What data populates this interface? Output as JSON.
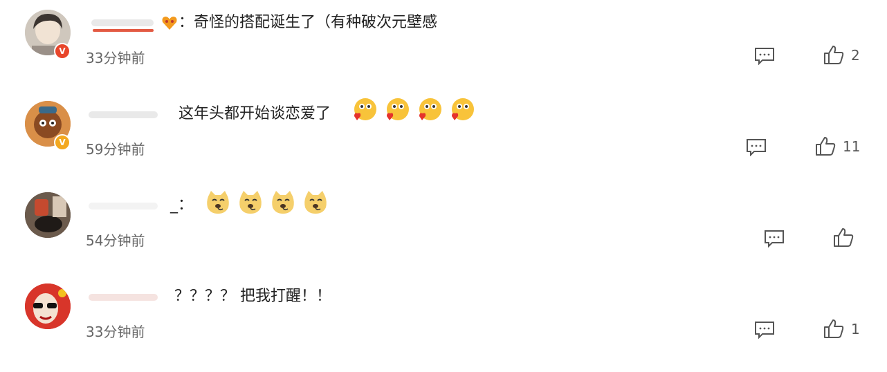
{
  "comments": [
    {
      "prefix": "：",
      "text": "奇怪的搭配诞生了（有种破次元壁感",
      "time": "33分钟前",
      "likes": "2",
      "badge": "red",
      "emoji_count": 0
    },
    {
      "prefix": "",
      "text": "这年头都开始谈恋爱了",
      "time": "59分钟前",
      "likes": "11",
      "badge": "gold",
      "emoji_count": 4
    },
    {
      "prefix": "_：",
      "text": "",
      "time": "54分钟前",
      "likes": "",
      "badge": "none",
      "emoji_count": 4
    },
    {
      "prefix": "",
      "text": "？？？？ 把我打醒！！",
      "time": "33分钟前",
      "likes": "1",
      "badge": "none",
      "emoji_count": 0
    }
  ],
  "icons": {
    "reply": "comment-bubble-icon",
    "like": "thumbs-up-icon",
    "heart-emoji": "blushing-heart-emoji-icon",
    "dog-emoji": "doge-emoji-icon"
  },
  "colors": {
    "verified_red": "#e8462b",
    "verified_gold": "#f3a81f",
    "text": "#222222",
    "meta": "#666666"
  }
}
